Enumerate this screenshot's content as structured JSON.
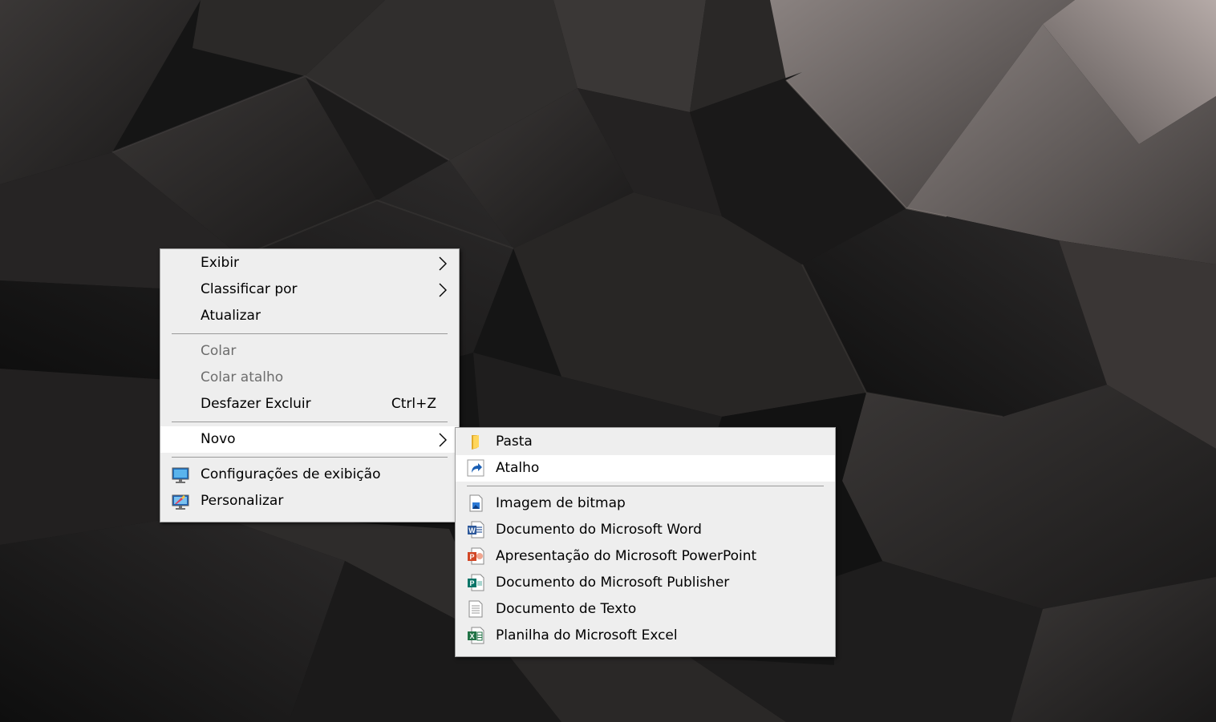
{
  "context_menu": {
    "items": [
      {
        "label": "Exibir",
        "icon": "none",
        "has_submenu": true,
        "disabled": false
      },
      {
        "label": "Classificar por",
        "icon": "none",
        "has_submenu": true,
        "disabled": false
      },
      {
        "label": "Atualizar",
        "icon": "none",
        "has_submenu": false,
        "disabled": false
      },
      {
        "label": "Colar",
        "icon": "none",
        "has_submenu": false,
        "disabled": true
      },
      {
        "label": "Colar atalho",
        "icon": "none",
        "has_submenu": false,
        "disabled": true
      },
      {
        "label": "Desfazer Excluir",
        "shortcut": "Ctrl+Z",
        "icon": "none",
        "has_submenu": false,
        "disabled": false
      },
      {
        "label": "Novo",
        "icon": "none",
        "has_submenu": true,
        "disabled": false,
        "highlighted": true
      },
      {
        "label": "Configurações de exibição",
        "icon": "display-settings-icon",
        "has_submenu": false,
        "disabled": false
      },
      {
        "label": "Personalizar",
        "icon": "personalize-icon",
        "has_submenu": false,
        "disabled": false
      }
    ]
  },
  "new_submenu": {
    "items": [
      {
        "label": "Pasta",
        "icon": "folder-icon"
      },
      {
        "label": "Atalho",
        "icon": "shortcut-icon",
        "highlighted": true
      },
      {
        "label": "Imagem de bitmap",
        "icon": "bitmap-icon"
      },
      {
        "label": "Documento do Microsoft Word",
        "icon": "word-icon"
      },
      {
        "label": "Apresentação do Microsoft PowerPoint",
        "icon": "powerpoint-icon"
      },
      {
        "label": "Documento do Microsoft Publisher",
        "icon": "publisher-icon"
      },
      {
        "label": "Documento de Texto",
        "icon": "text-document-icon"
      },
      {
        "label": "Planilha do Microsoft Excel",
        "icon": "excel-icon"
      }
    ]
  },
  "colors": {
    "menu_background": "#eeeeee",
    "highlight": "#ffffff",
    "disabled_text": "#6d6d6d",
    "word": "#2b579a",
    "powerpoint": "#d24726",
    "publisher": "#077568",
    "excel": "#217346"
  }
}
